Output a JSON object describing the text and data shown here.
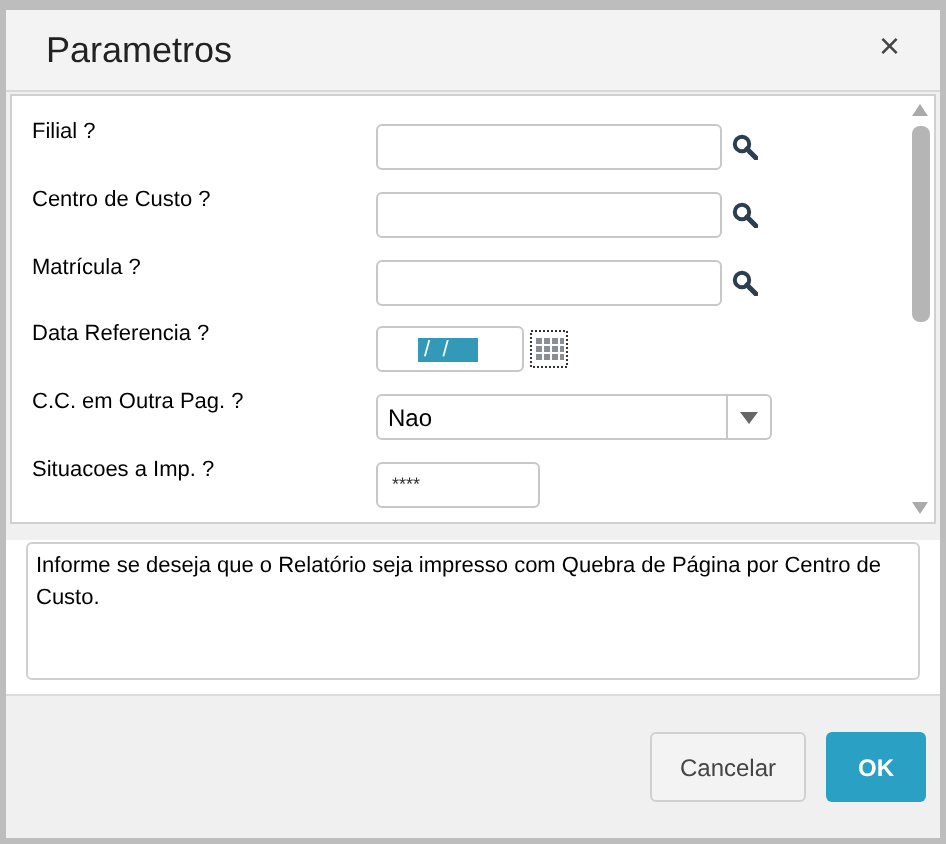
{
  "dialog": {
    "title": "Parametros",
    "close": "×"
  },
  "fields": [
    {
      "kind": "lookup",
      "label": "Filial ?"
    },
    {
      "kind": "lookup",
      "label": "Centro de Custo ?"
    },
    {
      "kind": "lookup",
      "label": "Matrícula ?"
    },
    {
      "kind": "date",
      "label": "Data Referencia ?",
      "value": " /  /"
    },
    {
      "kind": "select",
      "label": "C.C. em Outra Pag. ?",
      "value": "Nao"
    },
    {
      "kind": "text",
      "label": "Situacoes a Imp. ?",
      "value": "****"
    }
  ],
  "help_text": "Informe se deseja que o Relatório seja impresso com Quebra de Página por Centro de Custo.",
  "buttons": [
    {
      "label": "Cancelar",
      "kind": "secondary"
    },
    {
      "label": "OK",
      "kind": "primary"
    }
  ]
}
